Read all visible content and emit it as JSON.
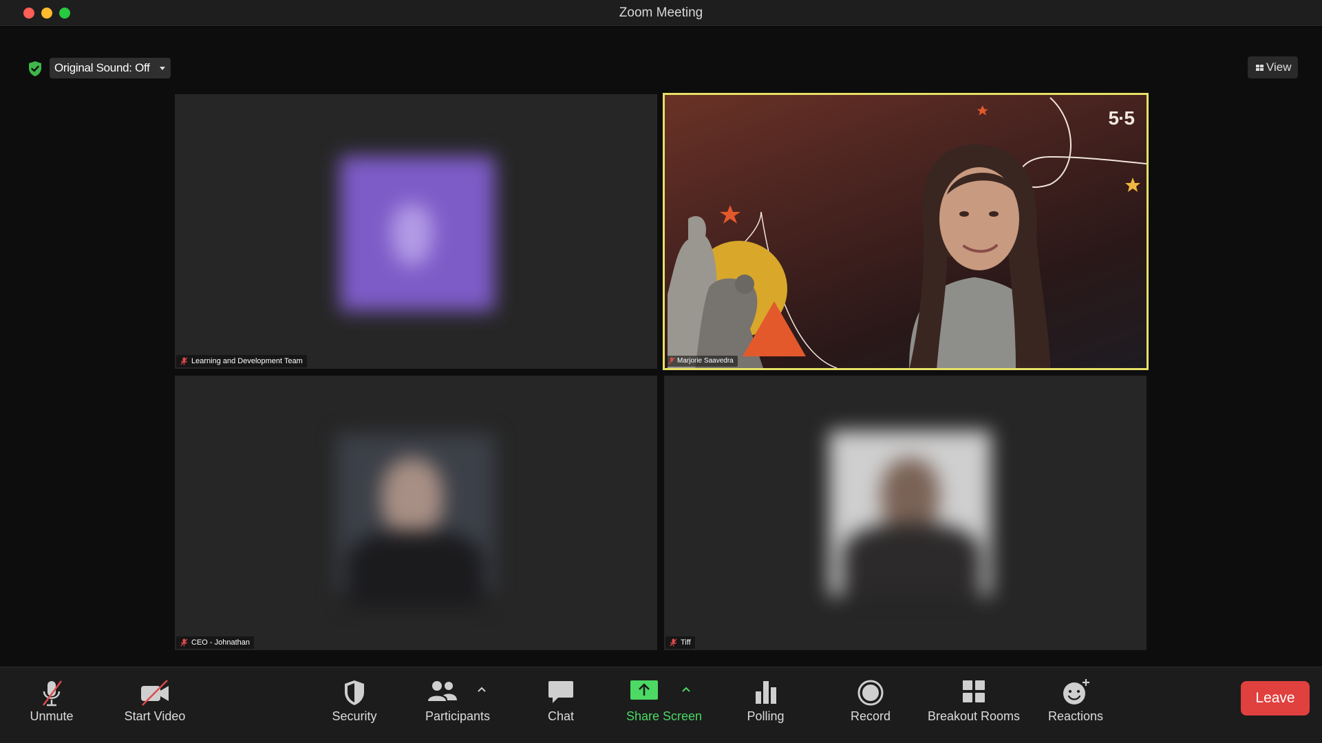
{
  "window": {
    "title": "Zoom Meeting"
  },
  "top_controls": {
    "original_sound_label": "Original Sound: Off",
    "view_label": "View"
  },
  "participants": [
    {
      "name": "Learning and Development Team",
      "muted": true,
      "active_speaker": false
    },
    {
      "name": "Marjorie Saavedra",
      "muted": true,
      "active_speaker": true,
      "background_badge": "5·5"
    },
    {
      "name": "CEO - Johnathan",
      "muted": true,
      "active_speaker": false
    },
    {
      "name": "Tiff",
      "muted": true,
      "active_speaker": false
    }
  ],
  "toolbar": {
    "unmute": "Unmute",
    "start_video": "Start Video",
    "security": "Security",
    "participants": "Participants",
    "chat": "Chat",
    "share_screen": "Share Screen",
    "polling": "Polling",
    "record": "Record",
    "breakout_rooms": "Breakout Rooms",
    "reactions": "Reactions",
    "leave": "Leave"
  },
  "colors": {
    "active_speaker_border": "#e6e166",
    "share_green": "#4cd964",
    "leave_red": "#e0403e",
    "security_shield": "#3fb64a"
  }
}
